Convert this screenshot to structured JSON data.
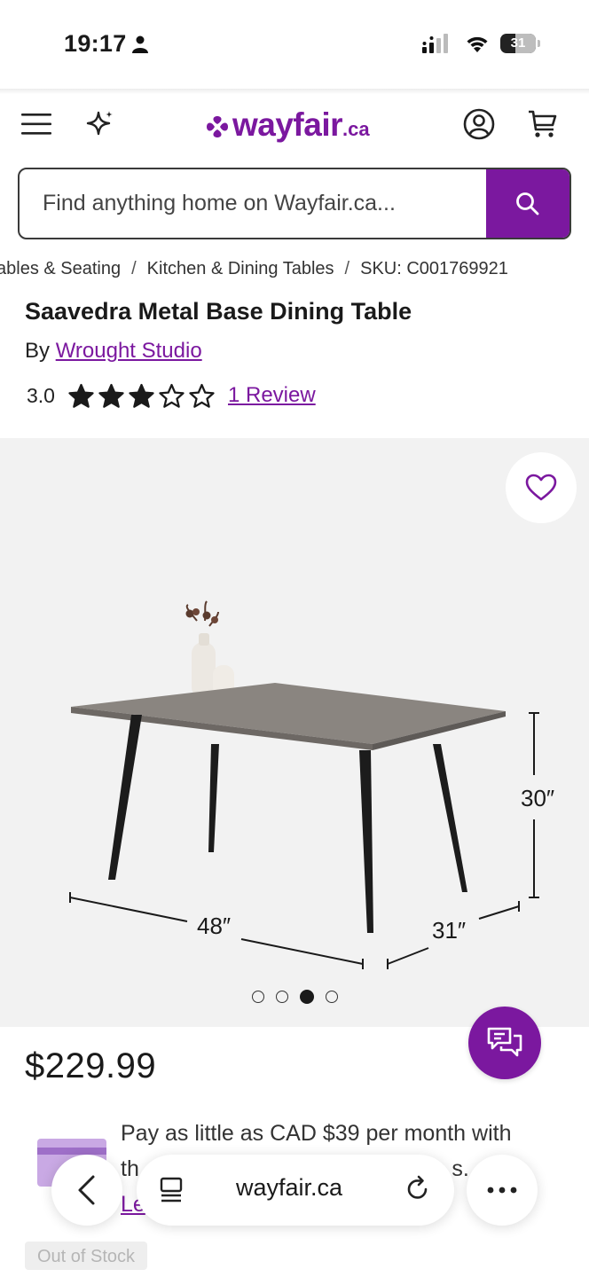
{
  "status_bar": {
    "time": "19:17",
    "battery": "31"
  },
  "header": {
    "logo_word": "wayfair",
    "logo_tld": ".ca",
    "brand_color": "#7b189f",
    "icons": [
      "menu-icon",
      "sparkle-icon",
      "account-icon",
      "cart-icon"
    ]
  },
  "search": {
    "placeholder": "Find anything home on Wayfair.ca..."
  },
  "breadcrumb": {
    "items": [
      "Tables & Seating",
      "Kitchen & Dining Tables",
      "SKU: C001769921"
    ],
    "separator": "/"
  },
  "product": {
    "title": "Saavedra Metal Base Dining Table",
    "by_label": "By",
    "brand": "Wrought Studio",
    "rating": "3.0",
    "rating_stars": 3,
    "max_stars": 5,
    "review_count": "1 Review",
    "price": "$229.99",
    "stock_status": "Out of Stock"
  },
  "gallery": {
    "dimensions": {
      "width": "48″",
      "depth": "31″",
      "height": "30″"
    },
    "image_count": 4,
    "active_index": 2
  },
  "financing": {
    "text_line1": "Pay as little as CAD $39 per month with",
    "text_line2_start": "th",
    "text_line2_end": "6 m    s.",
    "learn_link": "Le"
  },
  "browser": {
    "url": "wayfair.ca"
  }
}
